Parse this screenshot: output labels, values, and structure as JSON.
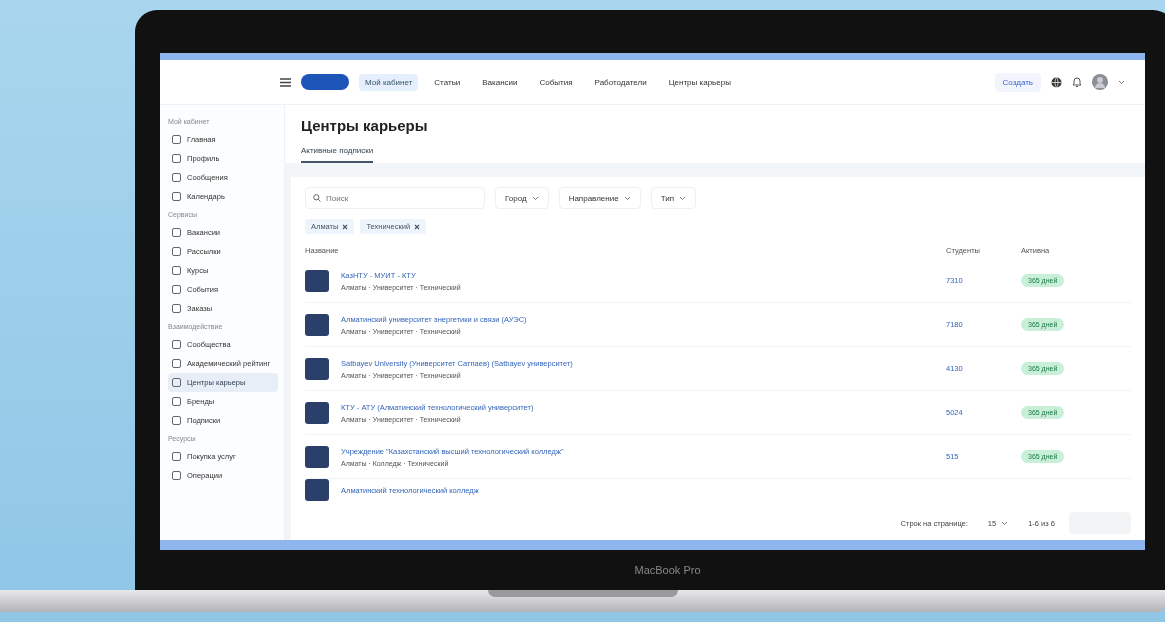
{
  "header": {
    "nav": [
      {
        "label": "Мой кабинет",
        "selected": true
      },
      {
        "label": "Статьи",
        "selected": false
      },
      {
        "label": "Вакансии",
        "selected": false
      },
      {
        "label": "События",
        "selected": false
      },
      {
        "label": "Работодатели",
        "selected": false
      },
      {
        "label": "Центры карьеры",
        "selected": false
      }
    ],
    "create_button": "Создать"
  },
  "sidebar": [
    {
      "title": "Мой кабинет",
      "items": [
        {
          "label": "Главная",
          "selected": false
        },
        {
          "label": "Профиль",
          "selected": false
        },
        {
          "label": "Сообщения",
          "selected": false
        },
        {
          "label": "Календарь",
          "selected": false
        }
      ]
    },
    {
      "title": "Сервисы",
      "items": [
        {
          "label": "Вакансии",
          "selected": false
        },
        {
          "label": "Рассылки",
          "selected": false
        },
        {
          "label": "Курсы",
          "selected": false
        },
        {
          "label": "События",
          "selected": false
        },
        {
          "label": "Заказы",
          "selected": false
        }
      ]
    },
    {
      "title": "Взаимодействие",
      "items": [
        {
          "label": "Сообщества",
          "selected": false
        },
        {
          "label": "Академический рейтинг",
          "selected": false
        },
        {
          "label": "Центры карьеры",
          "selected": true
        },
        {
          "label": "Бренды",
          "selected": false
        },
        {
          "label": "Подписки",
          "selected": false
        }
      ]
    },
    {
      "title": "Ресурсы",
      "items": [
        {
          "label": "Покупка услуг",
          "selected": false
        },
        {
          "label": "Операции",
          "selected": false
        }
      ]
    }
  ],
  "page": {
    "title": "Центры карьеры",
    "tabs": [
      {
        "label": "Активные подписки",
        "selected": true
      }
    ],
    "search": {
      "placeholder": "Поиск"
    },
    "filters": [
      "Город",
      "Направление",
      "Тип"
    ],
    "chips": [
      "Алматы",
      "Технический"
    ],
    "table": {
      "columns": [
        "Название",
        "Студенты",
        "Активна"
      ],
      "rows": [
        {
          "title": "КазНТУ - МУИТ - КТУ",
          "subtitle": "Алматы · Университет · Технический",
          "students": "7310",
          "badge": "365 дней"
        },
        {
          "title": "Алматинский университет энергетики и связи (АУЭС)",
          "subtitle": "Алматы · Университет · Технический",
          "students": "7180",
          "badge": "365 дней"
        },
        {
          "title": "Satbayev University (Университет Сатпаев) (Satbayev университет)",
          "subtitle": "Алматы · Университет · Технический",
          "students": "4130",
          "badge": "365 дней"
        },
        {
          "title": "КТУ - АТУ (Алматинский технологический университет)",
          "subtitle": "Алматы · Университет · Технический",
          "students": "5024",
          "badge": "365 дней"
        },
        {
          "title": "Учреждение \"Казахстанский высший технологический колледж\"",
          "subtitle": "Алматы · Колледж · Технический",
          "students": "515",
          "badge": "365 дней"
        },
        {
          "title": "Алматинский технологический колледж"
        }
      ]
    },
    "pagination": {
      "label": "Строк на странице:",
      "page_size": "15",
      "range": "1-6 из 6"
    }
  },
  "laptop": {
    "label": "MacBook Pro"
  }
}
